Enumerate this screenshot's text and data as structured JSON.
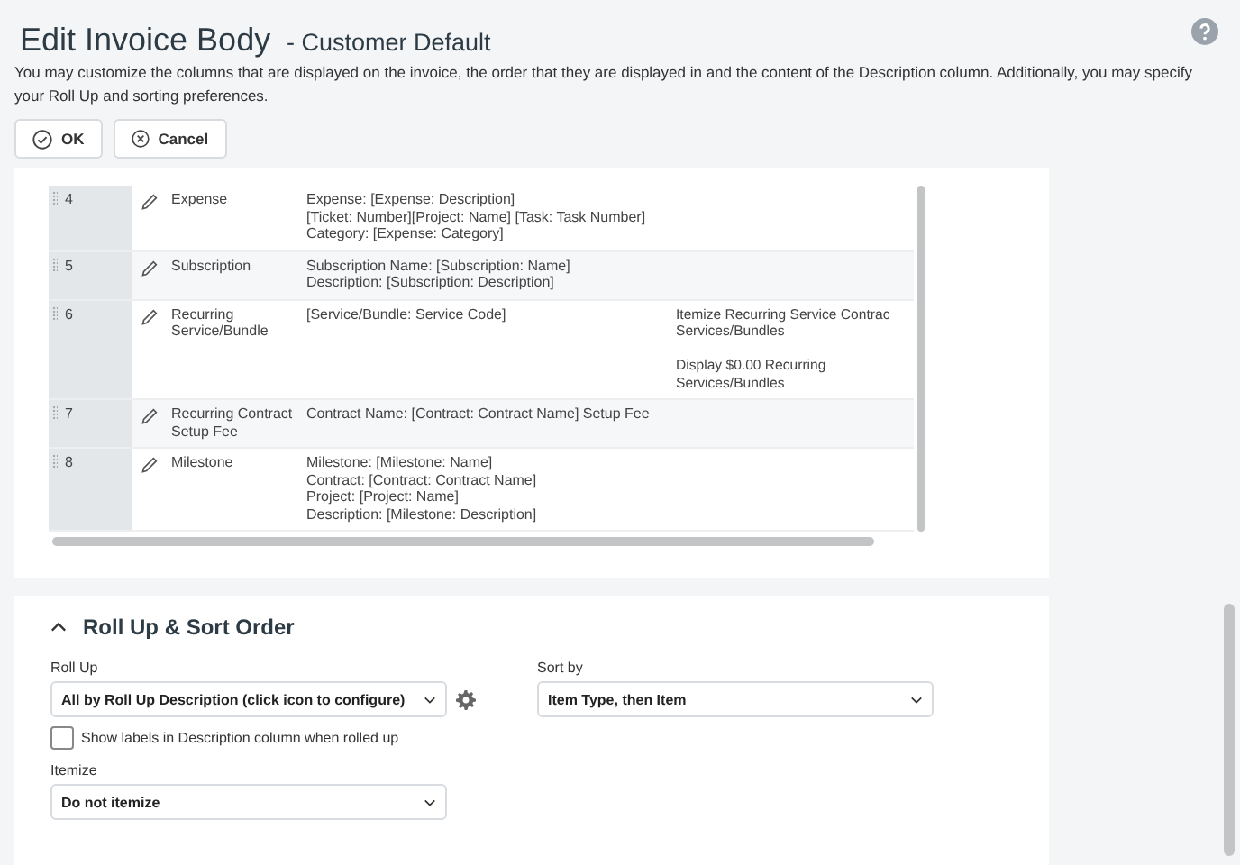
{
  "dialog": {
    "title": "Edit Invoice Body",
    "subtitle": "- Customer Default",
    "description": "You may customize the columns that are displayed on the invoice, the order that they are displayed in and the content of the Description column. Additionally, you may specify your Roll Up and sorting preferences.",
    "buttons": [
      {
        "label": "OK",
        "kind": "ok"
      },
      {
        "label": "Cancel",
        "kind": "cancel"
      }
    ]
  },
  "table": {
    "rows": [
      {
        "number": "4",
        "type": "Expense",
        "description": "Expense: [Expense: Description]\n[Ticket: Number][Project: Name]  [Task: Task Number]\nCategory: [Expense: Category]",
        "options": "",
        "kind": "row"
      },
      {
        "number": "5",
        "type": "Subscription",
        "description": "Subscription Name: [Subscription: Name]\nDescription: [Subscription: Description]",
        "options": "",
        "kind": "row"
      },
      {
        "number": "6",
        "type": "Recurring\nService/Bundle",
        "description": "[Service/Bundle: Service Code]",
        "options": "Itemize Recurring Service Contrac\nServices/Bundles\n\nDisplay $0.00 Recurring\nServices/Bundles",
        "kind": "row"
      },
      {
        "number": "7",
        "type": "Recurring Contract\nSetup Fee",
        "description": "Contract Name: [Contract: Contract Name] Setup Fee",
        "options": "",
        "kind": "row"
      },
      {
        "number": "8",
        "type": "Milestone",
        "description": "Milestone: [Milestone: Name]\nContract: [Contract: Contract Name]\nProject: [Project: Name]\nDescription: [Milestone: Description]",
        "options": "",
        "kind": "row"
      }
    ]
  },
  "rollup": {
    "title": "Roll Up & Sort Order",
    "expanded": true,
    "roll_up": {
      "label": "Roll Up",
      "value": "All by Roll Up Description (click icon to configure)"
    },
    "sort_by": {
      "label": "Sort by",
      "value": "Item Type, then Item"
    },
    "show_labels": {
      "label": "Show labels in Description column when rolled up",
      "checked": false
    },
    "itemize": {
      "label": "Itemize",
      "value": "Do not itemize"
    }
  }
}
